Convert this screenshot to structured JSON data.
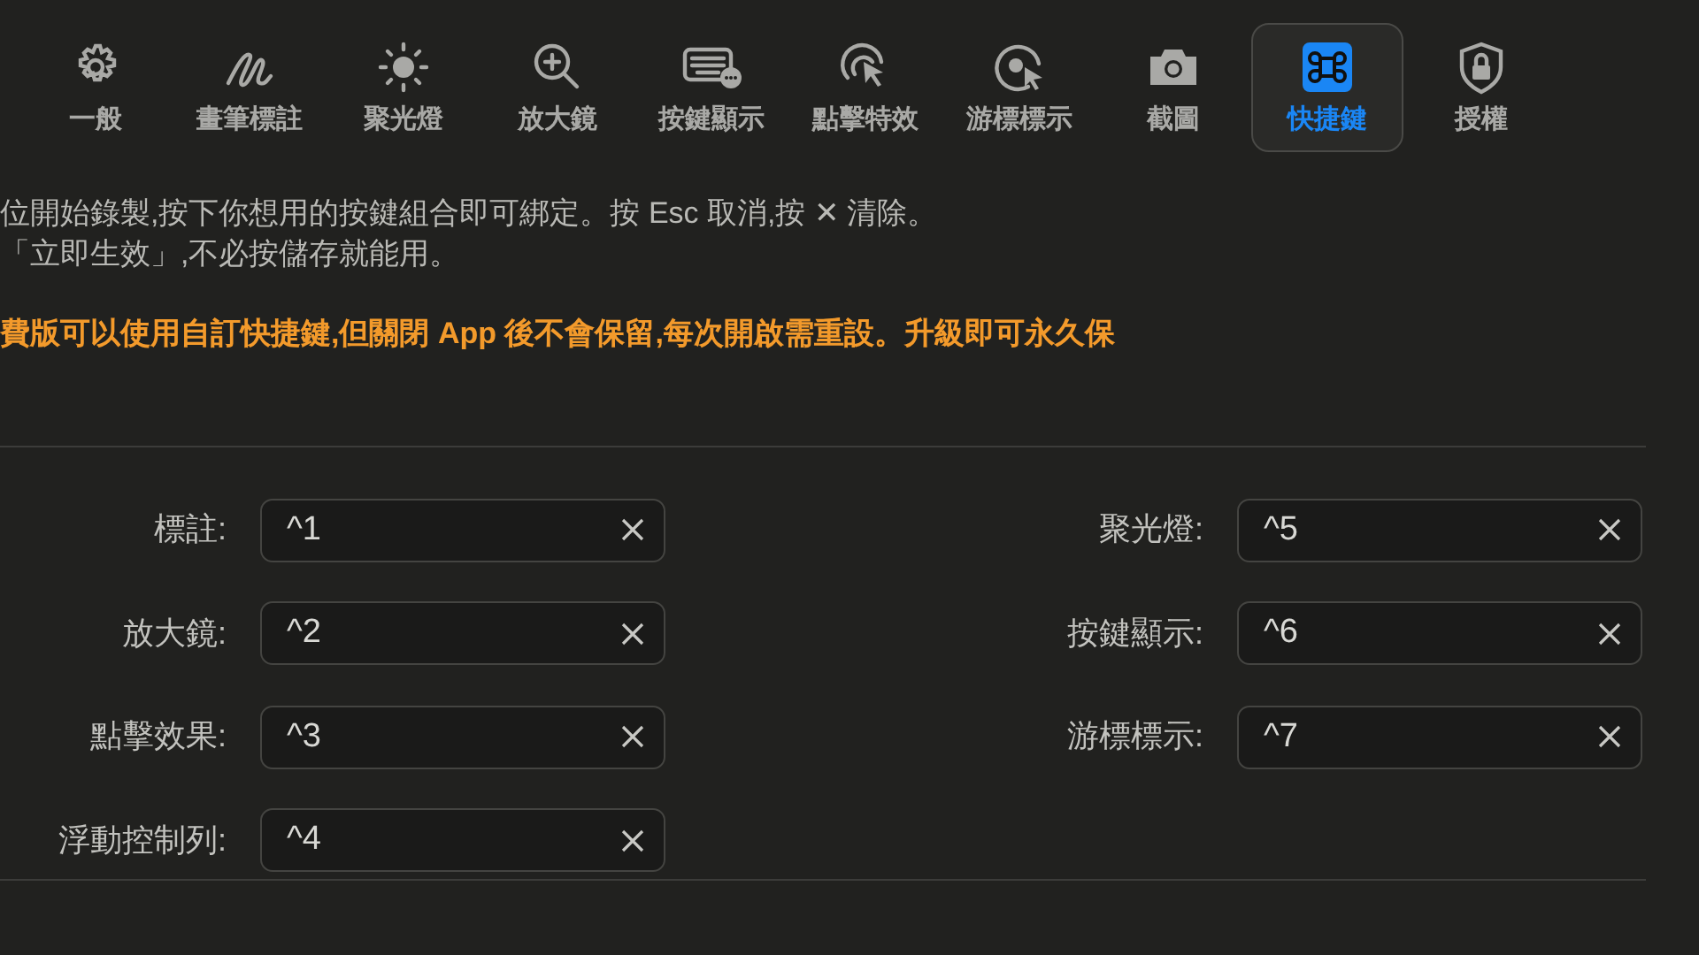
{
  "tabs": [
    {
      "label": "一般",
      "selected": false
    },
    {
      "label": "畫筆標註",
      "selected": false
    },
    {
      "label": "聚光燈",
      "selected": false
    },
    {
      "label": "放大鏡",
      "selected": false
    },
    {
      "label": "按鍵顯示",
      "selected": false
    },
    {
      "label": "點擊特效",
      "selected": false
    },
    {
      "label": "游標標示",
      "selected": false
    },
    {
      "label": "截圖",
      "selected": false
    },
    {
      "label": "快捷鍵",
      "selected": true
    },
    {
      "label": "授權",
      "selected": false
    }
  ],
  "instructions": [
    "位開始錄製,按下你想用的按鍵組合即可綁定。按 Esc 取消,按 ✕ 清除。",
    "「立即生效」,不必按儲存就能用。"
  ],
  "warning": "費版可以使用自訂快捷鍵,但關閉 App 後不會保留,每次開啟需重設。升級即可永久保",
  "shortcuts_left": [
    {
      "label": "標註:",
      "value": "^1"
    },
    {
      "label": "放大鏡:",
      "value": "^2"
    },
    {
      "label": "點擊效果:",
      "value": "^3"
    },
    {
      "label": "浮動控制列:",
      "value": "^4"
    }
  ],
  "shortcuts_right": [
    {
      "label": "聚光燈:",
      "value": "^5"
    },
    {
      "label": "按鍵顯示:",
      "value": "^6"
    },
    {
      "label": "游標標示:",
      "value": "^7"
    }
  ]
}
